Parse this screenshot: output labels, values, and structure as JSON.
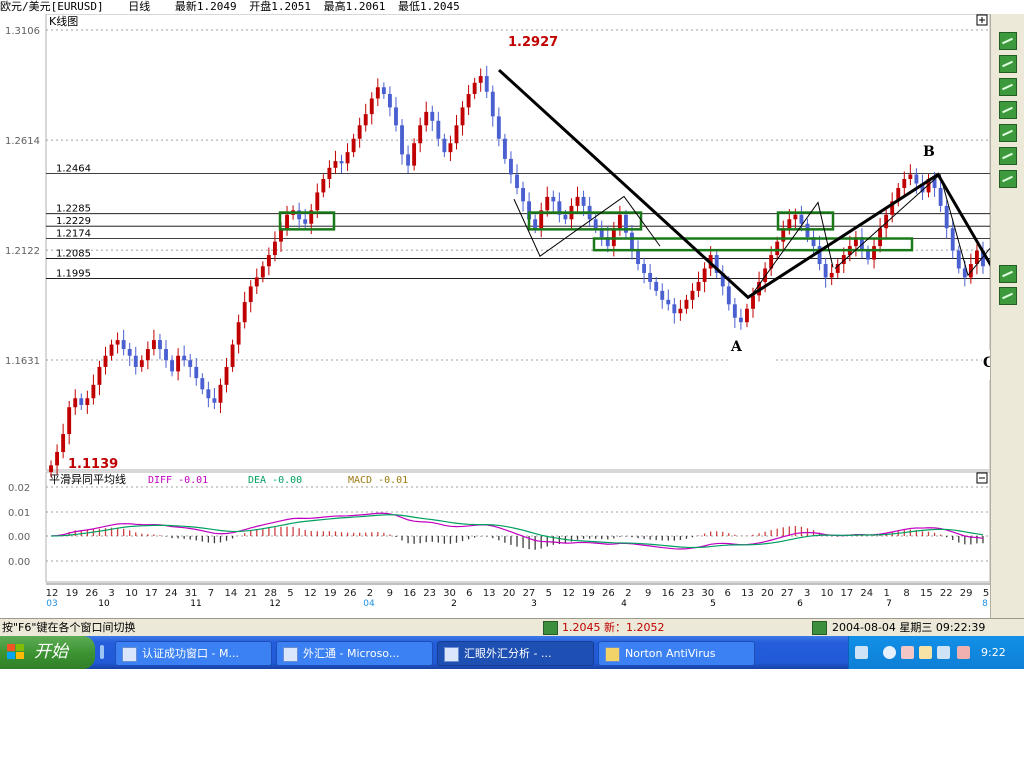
{
  "header": {
    "symbol": "欧元/美元[EURUSD]",
    "period": "日线",
    "latest": "最新1.2049",
    "open": "开盘1.2051",
    "high": "最高1.2061",
    "low": "最低1.2045"
  },
  "chart_data": {
    "type": "candlestick",
    "title": "K线图",
    "y_ticks": [
      "1.3106",
      "1.2614",
      "1.2122",
      "1.1631"
    ],
    "ylim": [
      1.105,
      1.3106
    ],
    "levels": [
      "1.2464",
      "1.2285",
      "1.2229",
      "1.2174",
      "1.2085",
      "1.1995"
    ],
    "annotations": {
      "high_label": "1.2927",
      "low_label": "1.1139",
      "A": "A",
      "B": "B",
      "C": "C",
      "q1": "?",
      "q2": "?"
    },
    "closes": [
      1.116,
      1.122,
      1.13,
      1.142,
      1.146,
      1.143,
      1.146,
      1.152,
      1.16,
      1.165,
      1.17,
      1.172,
      1.168,
      1.165,
      1.16,
      1.163,
      1.168,
      1.172,
      1.168,
      1.163,
      1.158,
      1.165,
      1.163,
      1.16,
      1.155,
      1.15,
      1.146,
      1.144,
      1.152,
      1.16,
      1.17,
      1.18,
      1.189,
      1.196,
      1.2,
      1.205,
      1.21,
      1.216,
      1.222,
      1.228,
      1.23,
      1.226,
      1.224,
      1.23,
      1.238,
      1.244,
      1.249,
      1.252,
      1.251,
      1.256,
      1.262,
      1.268,
      1.273,
      1.28,
      1.285,
      1.282,
      1.276,
      1.268,
      1.255,
      1.25,
      1.26,
      1.268,
      1.274,
      1.27,
      1.262,
      1.256,
      1.26,
      1.268,
      1.276,
      1.282,
      1.287,
      1.29,
      1.283,
      1.272,
      1.262,
      1.253,
      1.246,
      1.24,
      1.234,
      1.226,
      1.222,
      1.23,
      1.236,
      1.234,
      1.228,
      1.226,
      1.232,
      1.236,
      1.232,
      1.226,
      1.222,
      1.218,
      1.214,
      1.222,
      1.228,
      1.22,
      1.212,
      1.206,
      1.202,
      1.198,
      1.194,
      1.19,
      1.188,
      1.184,
      1.186,
      1.19,
      1.194,
      1.198,
      1.204,
      1.21,
      1.202,
      1.196,
      1.188,
      1.182,
      1.18,
      1.186,
      1.192,
      1.198,
      1.204,
      1.21,
      1.216,
      1.222,
      1.226,
      1.228,
      1.224,
      1.218,
      1.214,
      1.206,
      1.2,
      1.202,
      1.206,
      1.21,
      1.214,
      1.218,
      1.212,
      1.208,
      1.214,
      1.222,
      1.228,
      1.234,
      1.24,
      1.244,
      1.246,
      1.242,
      1.238,
      1.244,
      1.24,
      1.232,
      1.222,
      1.212,
      1.204,
      1.2,
      1.206,
      1.212,
      1.205
    ],
    "macd": {
      "title": "平滑异同平均线",
      "diff_label": "DIFF -0.01",
      "dea_label": "DEA -0.00",
      "macd_label": "MACD -0.01",
      "y_ticks": [
        "0.02",
        "0.01",
        "0.00",
        "0.00"
      ],
      "colors": {
        "diff": "#c000c0",
        "dea": "#00a060",
        "macd": "#9a7a10"
      }
    },
    "x_days": [
      "12",
      "19",
      "26",
      "3",
      "10",
      "17",
      "24",
      "31",
      "7",
      "14",
      "21",
      "28",
      "5",
      "12",
      "19",
      "26",
      "2",
      "9",
      "16",
      "23",
      "30",
      "6",
      "13",
      "20",
      "27",
      "5",
      "12",
      "19",
      "26",
      "2",
      "9",
      "16",
      "23",
      "30",
      "6",
      "13",
      "20",
      "27",
      "3",
      "10",
      "17",
      "24",
      "1",
      "8",
      "15",
      "22",
      "29",
      "5"
    ],
    "x_months": [
      {
        "label": "03",
        "color": "#2090e0"
      },
      {
        "label": "10",
        "color": "#000000"
      },
      {
        "label": "11",
        "color": "#000000"
      },
      {
        "label": "12",
        "color": "#000000"
      },
      {
        "label": "04",
        "color": "#2090e0"
      },
      {
        "label": "2",
        "color": "#000000"
      },
      {
        "label": "3",
        "color": "#000000"
      },
      {
        "label": "4",
        "color": "#000000"
      },
      {
        "label": "5",
        "color": "#000000"
      },
      {
        "label": "6",
        "color": "#000000"
      },
      {
        "label": "7",
        "color": "#000000"
      },
      {
        "label": "8",
        "color": "#2090e0"
      }
    ],
    "colors": {
      "up": "#c00000",
      "down": "#4a5fd0",
      "trend": "#000000",
      "box": "#1a7a1a",
      "grid": "#a0a0a0"
    }
  },
  "statusbar": {
    "hint": "按\"F6\"键在各个窗口间切换",
    "price": "1.2045 新：1.2052",
    "datetime": "2004-08-04 星期三 09:22:39"
  },
  "taskbar": {
    "start": "开始",
    "tasks": [
      "认证成功窗口 - M...",
      "外汇通 - Microso...",
      "汇眼外汇分析 - ...",
      "Norton AntiVirus"
    ],
    "clock": "9:22"
  }
}
